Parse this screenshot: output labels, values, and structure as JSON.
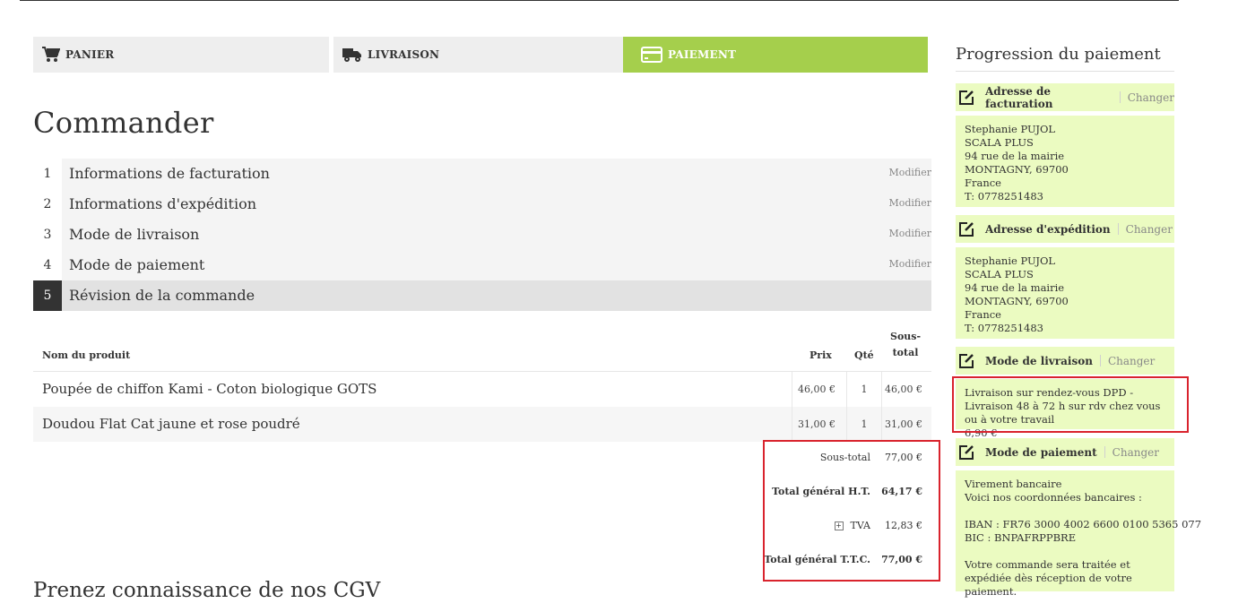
{
  "steps": [
    {
      "label": "PANIER",
      "icon": "cart-icon",
      "active": false
    },
    {
      "label": "LIVRAISON",
      "icon": "truck-icon",
      "active": false
    },
    {
      "label": "PAIEMENT",
      "icon": "credit-card-icon",
      "active": true
    }
  ],
  "colors": {
    "accent": "#a5cf4c",
    "sidebar_bg": "#ebfbc1",
    "highlight": "#d9232d"
  },
  "page_title": "Commander",
  "sections": [
    {
      "num": "1",
      "title": "Informations de facturation",
      "edit": "Modifier"
    },
    {
      "num": "2",
      "title": "Informations d'expédition",
      "edit": "Modifier"
    },
    {
      "num": "3",
      "title": "Mode de livraison",
      "edit": "Modifier"
    },
    {
      "num": "4",
      "title": "Mode de paiement",
      "edit": "Modifier"
    },
    {
      "num": "5",
      "title": "Révision de la commande",
      "edit": ""
    }
  ],
  "review": {
    "headers": {
      "name": "Nom du produit",
      "price": "Prix",
      "qty": "Qté",
      "subtotal_line1": "Sous-",
      "subtotal_line2": "total"
    },
    "items": [
      {
        "name": "Poupée de chiffon Kami - Coton biologique GOTS",
        "price": "46,00 €",
        "qty": "1",
        "subtotal": "46,00 €"
      },
      {
        "name": "Doudou Flat Cat jaune et rose poudré",
        "price": "31,00 €",
        "qty": "1",
        "subtotal": "31,00 €"
      }
    ],
    "totals": {
      "subtotal_label": "Sous-total",
      "subtotal_value": "77,00 €",
      "ht_label": "Total général H.T.",
      "ht_value": "64,17 €",
      "tva_toggle": "+",
      "tva_label": "TVA",
      "tva_value": "12,83 €",
      "ttc_label": "Total général T.T.C.",
      "ttc_value": "77,00 €"
    }
  },
  "cgv_title": "Prenez connaissance de nos CGV",
  "sidebar": {
    "title": "Progression du paiement",
    "change_label": "Changer",
    "billing": {
      "heading": "Adresse de facturation",
      "lines": [
        "Stephanie PUJOL",
        "SCALA PLUS",
        "94 rue de la mairie",
        "MONTAGNY, 69700",
        "France",
        "T: 0778251483"
      ]
    },
    "shipping": {
      "heading": "Adresse d'expédition",
      "lines": [
        "Stephanie PUJOL",
        "SCALA PLUS",
        "94 rue de la mairie",
        "MONTAGNY, 69700",
        "France",
        "T: 0778251483"
      ]
    },
    "delivery": {
      "heading": "Mode de livraison",
      "lines": [
        "Livraison sur rendez-vous DPD - Livraison 48 à 72 h sur rdv chez vous ou à votre travail",
        "6,90 €"
      ]
    },
    "payment": {
      "heading": "Mode de paiement",
      "lines": [
        "Virement bancaire",
        "Voici nos coordonnées bancaires :",
        "IBAN : FR76 3000 4002 6600 0100 5365 077",
        "BIC : BNPAFRPPBRE",
        "Votre commande sera traitée et expédiée dès réception de votre paiement."
      ]
    }
  }
}
